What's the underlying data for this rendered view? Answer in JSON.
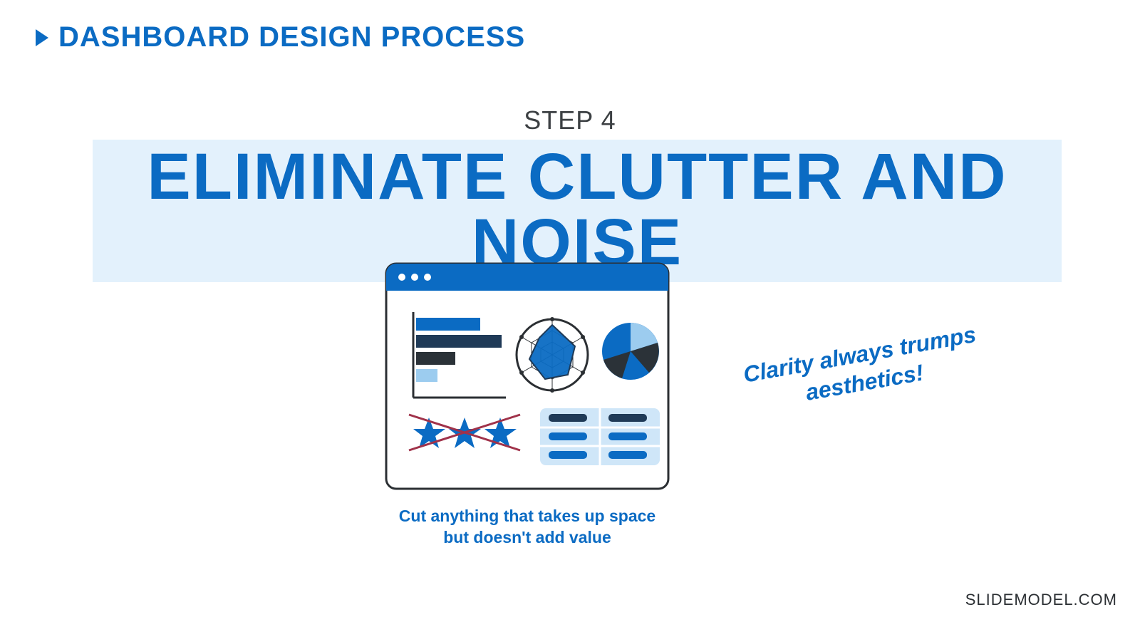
{
  "header": {
    "breadcrumb": "DASHBOARD DESIGN PROCESS"
  },
  "step": {
    "label": "STEP 4",
    "title": "ELIMINATE CLUTTER AND NOISE"
  },
  "illustration": {
    "caption": "Cut anything that takes up space but doesn't add value",
    "callout": "Clarity always trumps aesthetics!"
  },
  "footer": {
    "brand": "SLIDEMODEL.COM"
  },
  "colors": {
    "primary": "#0b6bc3",
    "dark": "#1f3a57",
    "light": "#9cccef",
    "band": "#e3f1fc"
  }
}
